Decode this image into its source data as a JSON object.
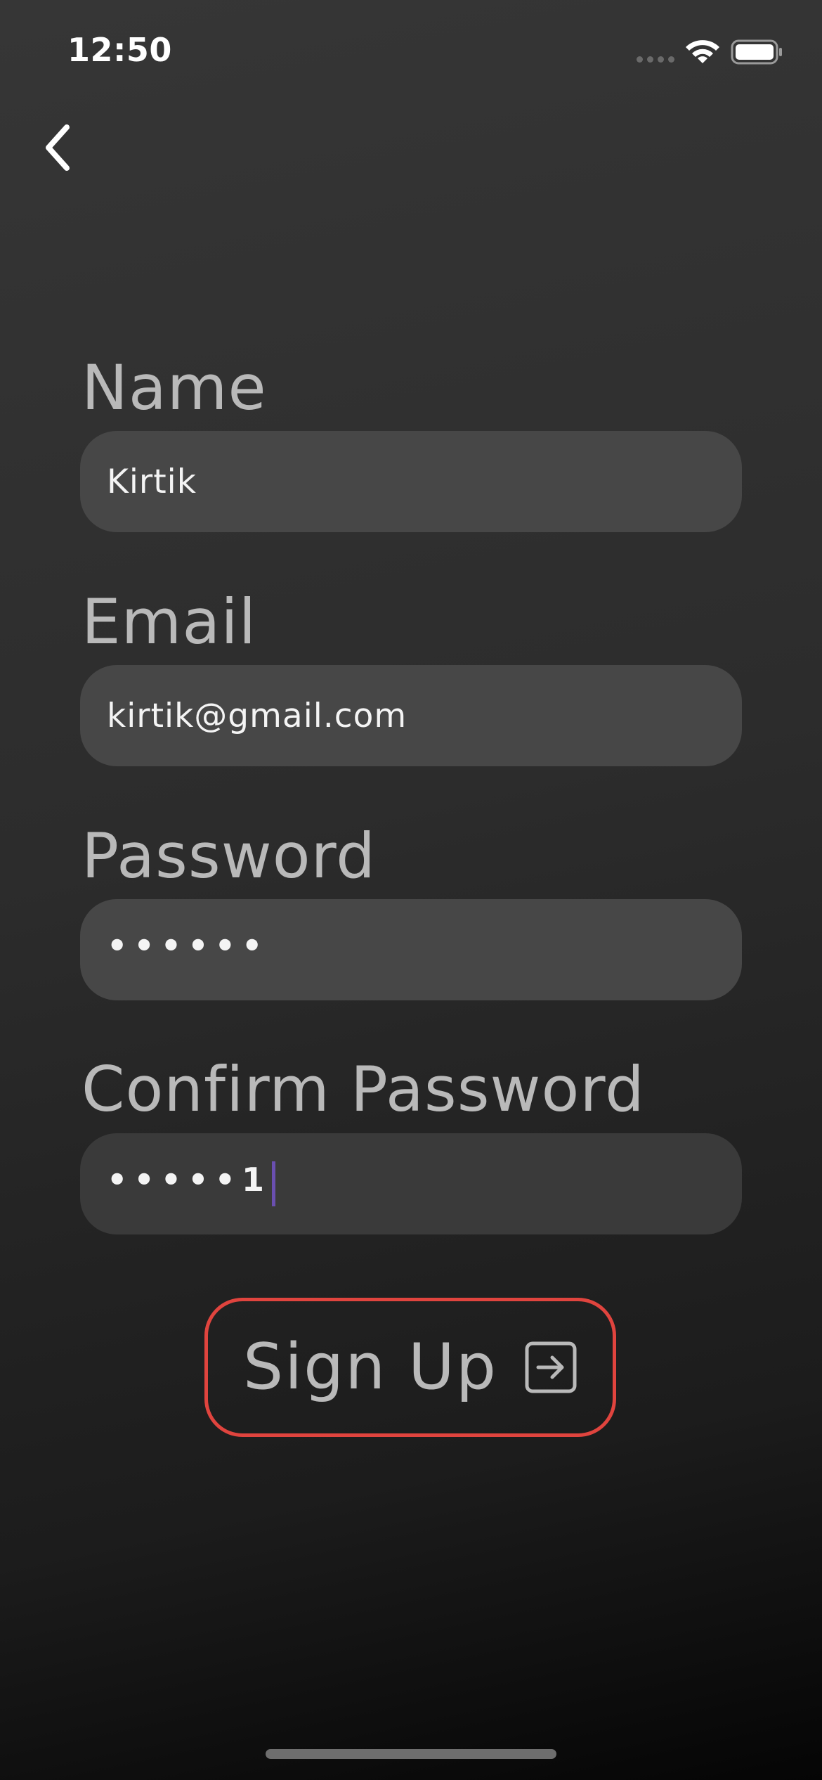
{
  "status_bar": {
    "time": "12:50",
    "icons": [
      "cellular-signal-icon",
      "wifi-icon",
      "battery-icon"
    ]
  },
  "nav": {
    "back_icon": "chevron-left-icon"
  },
  "form": {
    "name": {
      "label": "Name",
      "value": "Kirtik"
    },
    "email": {
      "label": "Email",
      "value": "kirtik@gmail.com"
    },
    "password": {
      "label": "Password",
      "value": "••••••"
    },
    "confirm_password": {
      "label": "Confirm Password",
      "value": "•••••1"
    }
  },
  "signup": {
    "label": "Sign Up",
    "icon": "arrow-right-square-icon",
    "border_color": "#e0443e"
  },
  "colors": {
    "label_text": "#b9b9b9",
    "input_bg": "#474747",
    "cursor": "#6a4fb0"
  }
}
